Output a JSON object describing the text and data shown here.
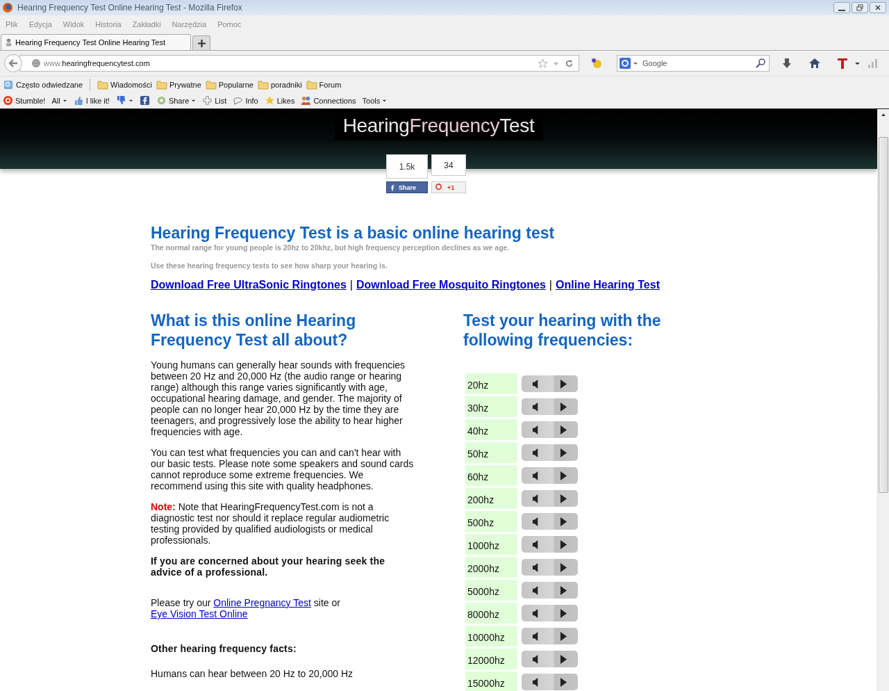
{
  "window": {
    "title": "Hearing Frequency Test Online Hearing Test - Mozilla Firefox"
  },
  "menu": [
    "Plik",
    "Edycja",
    "Widok",
    "Historia",
    "Zakładki",
    "Narzędzia",
    "Pomoc"
  ],
  "tabs": [
    {
      "label": "Hearing Frequency Test Online Hearing Test",
      "selected": true
    }
  ],
  "address": {
    "prefix": "www.",
    "domain": "hearingfrequencytest.com"
  },
  "search": {
    "placeholder": "Google"
  },
  "bookmarks": [
    {
      "label": "Często odwiedzane",
      "kind": "feed"
    },
    {
      "label": "Wiadomości",
      "kind": "folder"
    },
    {
      "label": "Prywatne",
      "kind": "folder"
    },
    {
      "label": "Popularne",
      "kind": "folder"
    },
    {
      "label": "poradniki",
      "kind": "folder"
    },
    {
      "label": "Forum",
      "kind": "folder"
    }
  ],
  "stumble_toolbar": [
    {
      "label": "Stumble!",
      "kind": "stumble",
      "dropdown": false
    },
    {
      "label": "All",
      "kind": "text",
      "dropdown": true
    },
    {
      "label": "I like it!",
      "kind": "thumbs-up",
      "dropdown": false
    },
    {
      "kind": "thumbs-down",
      "dropdown": true
    },
    {
      "kind": "facebook",
      "dropdown": false
    },
    {
      "label": "Share",
      "kind": "share",
      "dropdown": true
    },
    {
      "label": "List",
      "kind": "list",
      "dropdown": false
    },
    {
      "label": "Info",
      "kind": "info",
      "dropdown": false
    },
    {
      "label": "Likes",
      "kind": "star",
      "dropdown": false
    },
    {
      "label": "Connections",
      "kind": "people",
      "dropdown": false
    },
    {
      "label": "Tools",
      "kind": "text",
      "dropdown": true
    }
  ],
  "page": {
    "logo": [
      {
        "text": "Hearing",
        "color": "#e8e8e8"
      },
      {
        "text": "Frequency",
        "color": "#e8c8d0"
      },
      {
        "text": "Test",
        "color": "#e8e8e8"
      }
    ],
    "share": [
      {
        "kind": "facebook",
        "count": "1.5k",
        "label": "Share"
      },
      {
        "kind": "gplus",
        "count": "34",
        "label": "+1"
      }
    ],
    "heading": "Hearing Frequency Test is a basic online hearing test",
    "subtitles": [
      "The normal range for young people is 20hz to 20khz, but high frequency perception declines as we age.",
      "Use these hearing frequency tests to see how sharp your hearing is."
    ],
    "links": [
      "Download Free UltraSonic Ringtones",
      "Download Free Mosquito Ringtones",
      "Online Hearing Test"
    ],
    "link_separator": "|",
    "left": {
      "heading": "What is this online Hearing Frequency Test all about?",
      "blocks": [
        {
          "kind": "para",
          "parts": [
            {
              "text": "Young humans can generally hear sounds with frequencies between 20 Hz and 20,000 Hz (the audio range or hearing range) although this range varies significantly with age, occupational hearing damage, and gender. The majority of people can no longer hear 20,000 Hz by the time they are teenagers, and progressively lose the ability to hear higher frequencies with age."
            }
          ]
        },
        {
          "kind": "para",
          "parts": [
            {
              "text": "You can test what frequencies you can and can't hear with our basic tests. Please note some speakers and sound cards cannot reproduce some extreme frequencies. We recommend using this site with quality headphones."
            }
          ]
        },
        {
          "kind": "para",
          "parts": [
            {
              "kind": "note",
              "text": "Note:"
            },
            {
              "text": " Note that HearingFrequencyTest.com is not a diagnostic test nor should it replace regular audiometric testing provided by qualified audiologists or medical professionals."
            }
          ]
        },
        {
          "kind": "bold",
          "parts": [
            {
              "text": "If you are concerned about your hearing seek the advice of a professional."
            }
          ]
        },
        {
          "kind": "para",
          "parts": [
            {
              "text": "Please try our "
            },
            {
              "kind": "link",
              "text": "Online Pregnancy Test"
            },
            {
              "text": " site or "
            },
            {
              "kind": "link",
              "text": "Eye Vision Test Online"
            }
          ]
        },
        {
          "kind": "bold",
          "parts": [
            {
              "text": "Other hearing frequency facts:"
            }
          ]
        },
        {
          "kind": "para",
          "parts": [
            {
              "text": "Humans can hear between 20 Hz to 20,000 Hz"
            }
          ]
        }
      ]
    },
    "right": {
      "heading": "Test your hearing with the following frequencies:",
      "frequencies": [
        "20hz",
        "30hz",
        "40hz",
        "50hz",
        "60hz",
        "200hz",
        "500hz",
        "1000hz",
        "2000hz",
        "5000hz",
        "8000hz",
        "10000hz",
        "12000hz",
        "15000hz"
      ]
    }
  }
}
